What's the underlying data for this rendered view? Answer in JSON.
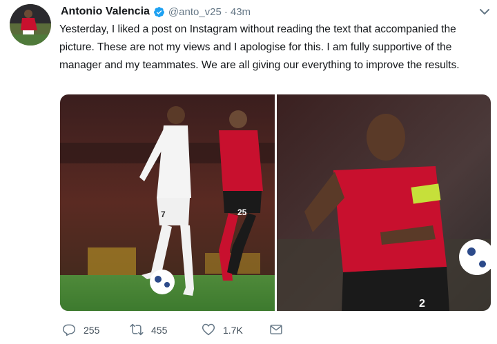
{
  "tweet": {
    "display_name": "Antonio Valencia",
    "handle": "@anto_v25",
    "separator": "·",
    "timestamp": "43m",
    "text": "Yesterday, I liked a post on Instagram without reading the text that accompanied the picture. These are not my views and I apologise for this. I am fully supportive of the manager and my teammates. We are all giving our everything to improve the results."
  },
  "actions": {
    "replies": "255",
    "retweets": "455",
    "likes": "1.7K"
  },
  "media": {
    "left_jersey_number": "7",
    "right_jersey_number": "25",
    "cropped_jersey_number": "2"
  },
  "icons": [
    "verified-badge-icon",
    "chevron-down-icon",
    "reply-icon",
    "retweet-icon",
    "like-icon",
    "message-icon"
  ],
  "colors": {
    "verified_blue": "#1da1f2",
    "muted_text": "#657786",
    "united_red": "#c8102e"
  }
}
